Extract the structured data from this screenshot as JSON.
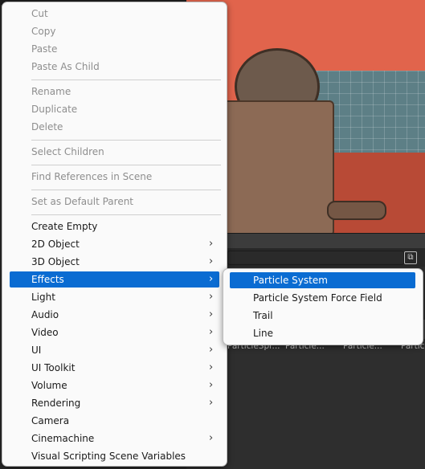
{
  "main_menu": {
    "items": [
      {
        "label": "Cut",
        "disabled": true,
        "submenu": false
      },
      {
        "label": "Copy",
        "disabled": true,
        "submenu": false
      },
      {
        "label": "Paste",
        "disabled": true,
        "submenu": false
      },
      {
        "label": "Paste As Child",
        "disabled": true,
        "submenu": false
      },
      {
        "label": "Rename",
        "disabled": true,
        "submenu": false
      },
      {
        "label": "Duplicate",
        "disabled": true,
        "submenu": false
      },
      {
        "label": "Delete",
        "disabled": true,
        "submenu": false
      },
      {
        "label": "Select Children",
        "disabled": true,
        "submenu": false
      },
      {
        "label": "Find References in Scene",
        "disabled": true,
        "submenu": false
      },
      {
        "label": "Set as Default Parent",
        "disabled": true,
        "submenu": false
      },
      {
        "label": "Create Empty",
        "disabled": false,
        "submenu": false
      },
      {
        "label": "2D Object",
        "disabled": false,
        "submenu": true
      },
      {
        "label": "3D Object",
        "disabled": false,
        "submenu": true
      },
      {
        "label": "Effects",
        "disabled": false,
        "submenu": true,
        "highlighted": true
      },
      {
        "label": "Light",
        "disabled": false,
        "submenu": true
      },
      {
        "label": "Audio",
        "disabled": false,
        "submenu": true
      },
      {
        "label": "Video",
        "disabled": false,
        "submenu": true
      },
      {
        "label": "UI",
        "disabled": false,
        "submenu": true
      },
      {
        "label": "UI Toolkit",
        "disabled": false,
        "submenu": true
      },
      {
        "label": "Volume",
        "disabled": false,
        "submenu": true
      },
      {
        "label": "Rendering",
        "disabled": false,
        "submenu": true
      },
      {
        "label": "Camera",
        "disabled": false,
        "submenu": false
      },
      {
        "label": "Cinemachine",
        "disabled": false,
        "submenu": true
      },
      {
        "label": "Visual Scripting Scene Variables",
        "disabled": false,
        "submenu": false
      }
    ]
  },
  "effects_submenu": {
    "items": [
      {
        "label": "Particle System",
        "highlighted": true
      },
      {
        "label": "Particle System Force Field"
      },
      {
        "label": "Trail"
      },
      {
        "label": "Line"
      }
    ]
  },
  "project_panel": {
    "asset_labels": [
      "ParticleSpr...",
      "Particle...",
      "Particle...",
      "Particl"
    ]
  },
  "colors": {
    "highlight": "#0a6cd2",
    "menu_bg": "#fafafa",
    "disabled_text": "#8e8e8e",
    "scene_bg": "#e1644c"
  },
  "icons": {
    "submenu_arrow": "chevron-right-icon",
    "panel_toggle": "panel-toggle-icon"
  }
}
